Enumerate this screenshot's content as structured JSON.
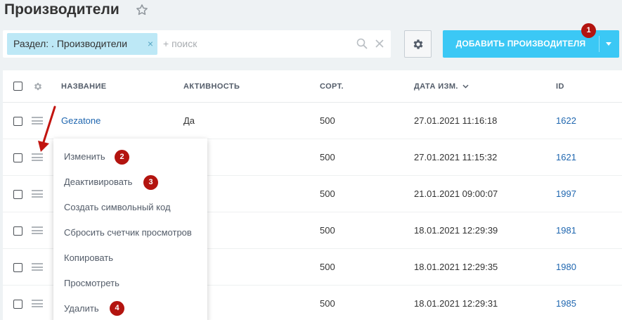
{
  "header": {
    "title": "Производители"
  },
  "filter": {
    "tag_label": "Раздел: . Производители",
    "tag_close": "×",
    "search_placeholder": "+ поиск"
  },
  "toolbar": {
    "add_label": "ДОБАВИТЬ ПРОИЗВОДИТЕЛЯ"
  },
  "table": {
    "columns": {
      "name": "НАЗВАНИЕ",
      "active": "АКТИВНОСТЬ",
      "sort": "СОРТ.",
      "date": "ДАТА ИЗМ.",
      "id": "ID"
    },
    "rows": [
      {
        "name": "Gezatone",
        "active": "Да",
        "sort": "500",
        "date": "27.01.2021 11:16:18",
        "id": "1622"
      },
      {
        "name": "",
        "active": "",
        "sort": "500",
        "date": "27.01.2021 11:15:32",
        "id": "1621"
      },
      {
        "name": "",
        "active": "",
        "sort": "500",
        "date": "21.01.2021 09:00:07",
        "id": "1997"
      },
      {
        "name": "",
        "active": "",
        "sort": "500",
        "date": "18.01.2021 12:29:39",
        "id": "1981"
      },
      {
        "name": "",
        "active": "",
        "sort": "500",
        "date": "18.01.2021 12:29:35",
        "id": "1980"
      },
      {
        "name": "",
        "active": "",
        "sort": "500",
        "date": "18.01.2021 12:29:31",
        "id": "1985"
      }
    ]
  },
  "context_menu": {
    "items": [
      "Изменить",
      "Деактивировать",
      "Создать символьный код",
      "Сбросить счетчик просмотров",
      "Копировать",
      "Просмотреть",
      "Удалить"
    ]
  },
  "badges": [
    "1",
    "2",
    "3",
    "4"
  ],
  "icons": [
    "star-icon",
    "search-icon",
    "close-icon",
    "gear-icon",
    "chevron-down-icon",
    "menu-icon",
    "sort-desc-icon"
  ],
  "colors": {
    "accent": "#3bc8f5",
    "badge": "#b3140f",
    "link": "#2067b0",
    "tag": "#bde8f6"
  }
}
